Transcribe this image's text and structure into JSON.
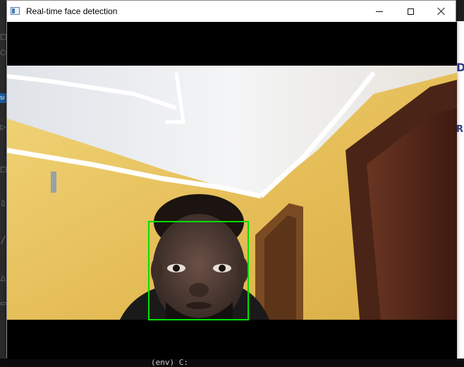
{
  "window": {
    "title": "Real-time face detection",
    "controls": {
      "minimize_icon": "minimize-icon",
      "maximize_icon": "maximize-icon",
      "close_icon": "close-icon"
    }
  },
  "video": {
    "detections": [
      {
        "label": "face",
        "box_color": "#00e000"
      }
    ]
  },
  "background": {
    "terminal_prompt": "(env)  C:"
  },
  "colors": {
    "titlebar": "#ffffff",
    "canvas": "#000000",
    "wall": "#e8c15a",
    "ceiling": "#e9ecef",
    "door": "#5a2a1a",
    "detection_box": "#00e000"
  }
}
